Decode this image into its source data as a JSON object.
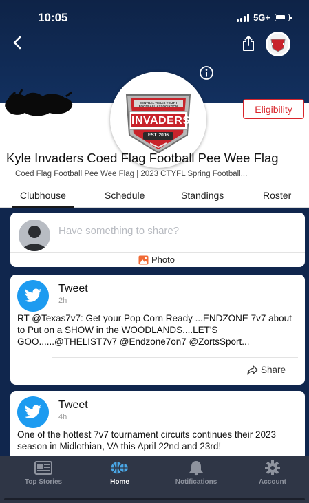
{
  "status_bar": {
    "time": "10:05",
    "network": "5G+"
  },
  "header": {
    "eligibility_label": "Eligibility"
  },
  "team": {
    "title": "Kyle Invaders Coed Flag Football Pee Wee Flag",
    "subtitle": "Coed Flag Football Pee Wee Flag | 2023 CTYFL Spring Football...",
    "logo": {
      "top_text": "CENTRAL TEXAS YOUTH FOOTBALL ASSOCIATION",
      "name": "INVADERS",
      "est": "EST. 2006"
    }
  },
  "tabs": [
    {
      "label": "Clubhouse",
      "active": true
    },
    {
      "label": "Schedule",
      "active": false
    },
    {
      "label": "Standings",
      "active": false
    },
    {
      "label": "Roster",
      "active": false
    }
  ],
  "composer": {
    "placeholder": "Have something to share?",
    "photo_label": "Photo"
  },
  "posts": [
    {
      "title": "Tweet",
      "time": "2h",
      "body": "RT @Texas7v7: Get your Pop Corn Ready ...ENDZONE 7v7 about to Put on a SHOW in the WOODLANDS....LET'S GOO......@THELIST7v7 @Endzone7on7 @ZortsSport...",
      "share_label": "Share"
    },
    {
      "title": "Tweet",
      "time": "4h",
      "body": "One of the hottest 7v7 tournament circuits continues their 2023 season in Midlothian, VA this April 22nd and 23rd!"
    }
  ],
  "bottom_nav": [
    {
      "label": "Top Stories",
      "icon": "newspaper-icon",
      "active": false
    },
    {
      "label": "Home",
      "icon": "basketball-icon",
      "active": true
    },
    {
      "label": "Notifications",
      "icon": "bell-icon",
      "active": false
    },
    {
      "label": "Account",
      "icon": "gear-icon",
      "active": false
    }
  ],
  "colors": {
    "header_bg": "#12305f",
    "feed_bg": "#10264d",
    "accent_red": "#d9252a",
    "twitter_blue": "#1d9bf0",
    "nav_bg": "#2f3646"
  }
}
